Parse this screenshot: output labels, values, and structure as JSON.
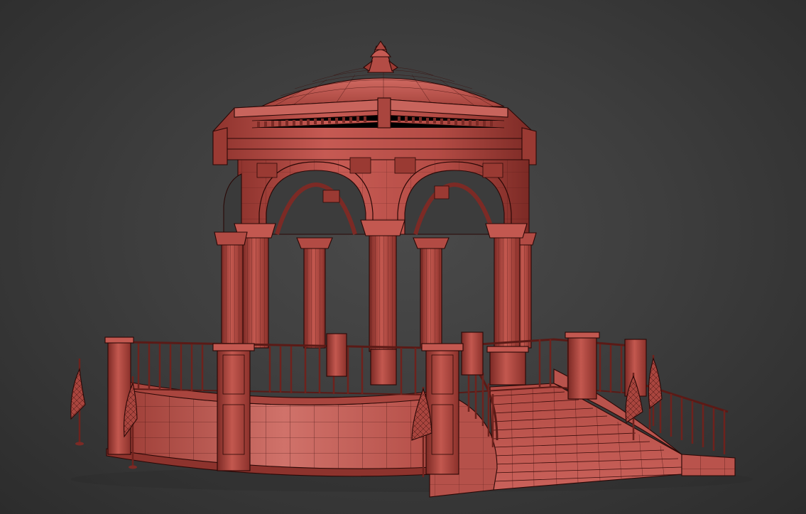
{
  "scene": {
    "subject": "gazebo-wireframe",
    "colors": {
      "background_center": "#4a4a4a",
      "background_edge": "#2c2c2c",
      "mesh_light": "#c9615a",
      "mesh_mid": "#b04a43",
      "mesh_dark": "#7c2a25",
      "wire": "#3a0d0b"
    }
  }
}
